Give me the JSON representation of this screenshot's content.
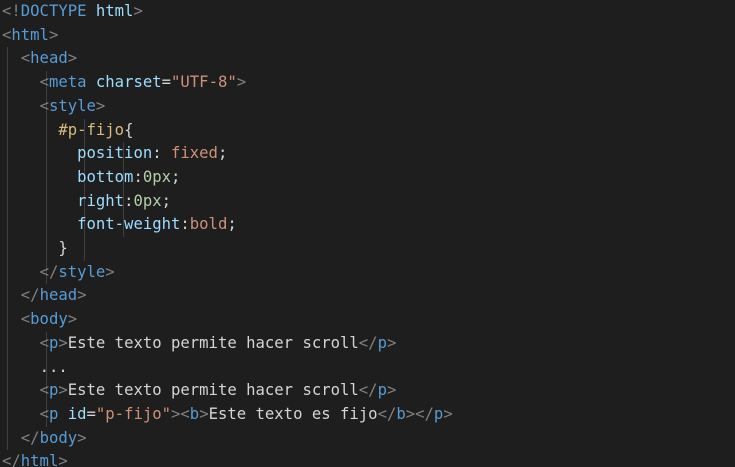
{
  "editor": {
    "theme_colors": {
      "background": "#1e1e1e",
      "punctuation": "#808080",
      "tag": "#569cd6",
      "attribute": "#9cdcfe",
      "string": "#ce9178",
      "selector": "#d7ba7d",
      "property": "#9cdcfe",
      "value": "#ce9178",
      "number": "#b5cea8",
      "text": "#d4d4d4"
    },
    "lines": [
      [
        {
          "t": "punct",
          "v": "<!"
        },
        {
          "t": "tag",
          "v": "DOCTYPE"
        },
        {
          "t": "text",
          "v": " "
        },
        {
          "t": "attr",
          "v": "html"
        },
        {
          "t": "punct",
          "v": ">"
        }
      ],
      [
        {
          "t": "punct",
          "v": "<"
        },
        {
          "t": "tag",
          "v": "html"
        },
        {
          "t": "punct",
          "v": ">"
        }
      ],
      [
        {
          "t": "text",
          "v": "  "
        },
        {
          "t": "punct",
          "v": "<"
        },
        {
          "t": "tag",
          "v": "head"
        },
        {
          "t": "punct",
          "v": ">"
        }
      ],
      [
        {
          "t": "text",
          "v": "    "
        },
        {
          "t": "punct",
          "v": "<"
        },
        {
          "t": "tag",
          "v": "meta"
        },
        {
          "t": "text",
          "v": " "
        },
        {
          "t": "attr",
          "v": "charset"
        },
        {
          "t": "text",
          "v": "="
        },
        {
          "t": "str",
          "v": "\"UTF-8\""
        },
        {
          "t": "punct",
          "v": ">"
        }
      ],
      [
        {
          "t": "text",
          "v": "    "
        },
        {
          "t": "punct",
          "v": "<"
        },
        {
          "t": "tag",
          "v": "style"
        },
        {
          "t": "punct",
          "v": ">"
        }
      ],
      [
        {
          "t": "text",
          "v": "      "
        },
        {
          "t": "sel",
          "v": "#p-fijo"
        },
        {
          "t": "text",
          "v": "{"
        }
      ],
      [
        {
          "t": "text",
          "v": "        "
        },
        {
          "t": "prop",
          "v": "position"
        },
        {
          "t": "text",
          "v": ": "
        },
        {
          "t": "val",
          "v": "fixed"
        },
        {
          "t": "text",
          "v": ";"
        }
      ],
      [
        {
          "t": "text",
          "v": "        "
        },
        {
          "t": "prop",
          "v": "bottom"
        },
        {
          "t": "text",
          "v": ":"
        },
        {
          "t": "num",
          "v": "0px"
        },
        {
          "t": "text",
          "v": ";"
        }
      ],
      [
        {
          "t": "text",
          "v": "        "
        },
        {
          "t": "prop",
          "v": "right"
        },
        {
          "t": "text",
          "v": ":"
        },
        {
          "t": "num",
          "v": "0px"
        },
        {
          "t": "text",
          "v": ";"
        }
      ],
      [
        {
          "t": "text",
          "v": "        "
        },
        {
          "t": "prop",
          "v": "font-weight"
        },
        {
          "t": "text",
          "v": ":"
        },
        {
          "t": "val",
          "v": "bold"
        },
        {
          "t": "text",
          "v": ";"
        }
      ],
      [
        {
          "t": "text",
          "v": "      "
        },
        {
          "t": "text",
          "v": "}"
        }
      ],
      [
        {
          "t": "text",
          "v": "    "
        },
        {
          "t": "punct",
          "v": "</"
        },
        {
          "t": "tag",
          "v": "style"
        },
        {
          "t": "punct",
          "v": ">"
        }
      ],
      [
        {
          "t": "text",
          "v": "  "
        },
        {
          "t": "punct",
          "v": "</"
        },
        {
          "t": "tag",
          "v": "head"
        },
        {
          "t": "punct",
          "v": ">"
        }
      ],
      [
        {
          "t": "text",
          "v": "  "
        },
        {
          "t": "punct",
          "v": "<"
        },
        {
          "t": "tag",
          "v": "body"
        },
        {
          "t": "punct",
          "v": ">"
        }
      ],
      [
        {
          "t": "text",
          "v": "    "
        },
        {
          "t": "punct",
          "v": "<"
        },
        {
          "t": "tag",
          "v": "p"
        },
        {
          "t": "punct",
          "v": ">"
        },
        {
          "t": "text",
          "v": "Este texto permite hacer scroll"
        },
        {
          "t": "punct",
          "v": "</"
        },
        {
          "t": "tag",
          "v": "p"
        },
        {
          "t": "punct",
          "v": ">"
        }
      ],
      [
        {
          "t": "text",
          "v": "    "
        },
        {
          "t": "text",
          "v": "..."
        }
      ],
      [
        {
          "t": "text",
          "v": "    "
        },
        {
          "t": "punct",
          "v": "<"
        },
        {
          "t": "tag",
          "v": "p"
        },
        {
          "t": "punct",
          "v": ">"
        },
        {
          "t": "text",
          "v": "Este texto permite hacer scroll"
        },
        {
          "t": "punct",
          "v": "</"
        },
        {
          "t": "tag",
          "v": "p"
        },
        {
          "t": "punct",
          "v": ">"
        }
      ],
      [
        {
          "t": "text",
          "v": "    "
        },
        {
          "t": "punct",
          "v": "<"
        },
        {
          "t": "tag",
          "v": "p"
        },
        {
          "t": "text",
          "v": " "
        },
        {
          "t": "attr",
          "v": "id"
        },
        {
          "t": "text",
          "v": "="
        },
        {
          "t": "str",
          "v": "\"p-fijo\""
        },
        {
          "t": "punct",
          "v": "><"
        },
        {
          "t": "tag",
          "v": "b"
        },
        {
          "t": "punct",
          "v": ">"
        },
        {
          "t": "text",
          "v": "Este texto es fijo"
        },
        {
          "t": "punct",
          "v": "</"
        },
        {
          "t": "tag",
          "v": "b"
        },
        {
          "t": "punct",
          "v": "></"
        },
        {
          "t": "tag",
          "v": "p"
        },
        {
          "t": "punct",
          "v": ">"
        }
      ],
      [
        {
          "t": "text",
          "v": "  "
        },
        {
          "t": "punct",
          "v": "</"
        },
        {
          "t": "tag",
          "v": "body"
        },
        {
          "t": "punct",
          "v": ">"
        }
      ],
      [
        {
          "t": "punct",
          "v": "</"
        },
        {
          "t": "tag",
          "v": "html"
        },
        {
          "t": "punct",
          "v": ">"
        }
      ]
    ]
  }
}
